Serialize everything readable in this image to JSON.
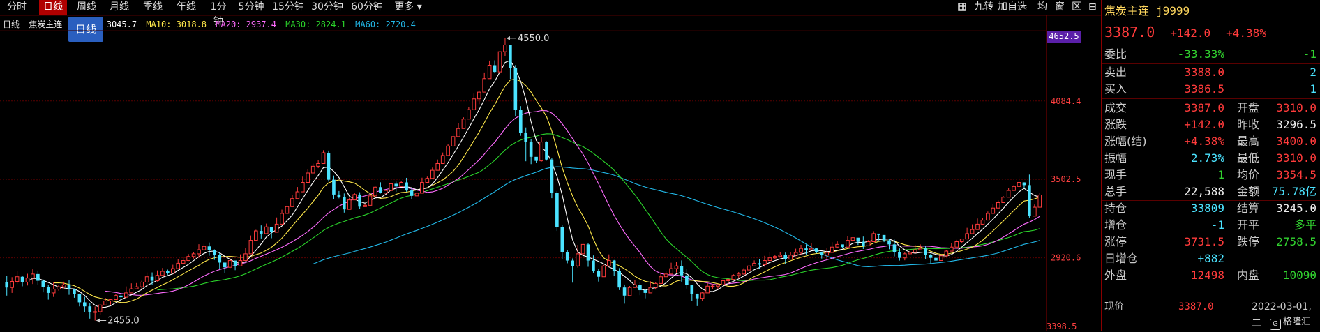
{
  "periods": [
    "分时",
    "日线",
    "周线",
    "月线",
    "季线",
    "年线",
    "1分钟",
    "5分钟",
    "15分钟",
    "30分钟",
    "60分钟",
    "更多 ▾"
  ],
  "active_period": 1,
  "tools": [
    "九转",
    "加自选",
    "均",
    "窗",
    "区"
  ],
  "legend": {
    "period": "日线",
    "name": "焦炭主连",
    "ma5": "3045.7",
    "ma10": "MA10: 3018.8",
    "ma20": "MA20: 2937.4",
    "ma30": "MA30: 2824.1",
    "ma60": "MA60: 2720.4"
  },
  "tooltip_label": "日线",
  "price_box": "4652.5",
  "colors": {
    "up": "#ff3b3b",
    "down": "#4be3ff",
    "ma5": "#ffffff",
    "ma10": "#ffe84a",
    "ma20": "#ff6cff",
    "ma30": "#2bd42b",
    "ma60": "#22b8e8",
    "grid": "#5a0000"
  },
  "panel": {
    "title": "焦炭主连",
    "code": "j9999",
    "price": "3387.0",
    "change": "+142.0",
    "change_pct": "+4.38%",
    "weibi": {
      "label": "委比",
      "pct": "-33.33%",
      "val": "-1"
    },
    "sell": {
      "label": "卖出",
      "price": "3388.0",
      "vol": "2"
    },
    "buy": {
      "label": "买入",
      "price": "3386.5",
      "vol": "1"
    },
    "rows": [
      {
        "l1": "成交",
        "v1": "3387.0",
        "c1": "red",
        "l2": "开盘",
        "v2": "3310.0",
        "c2": "red"
      },
      {
        "l1": "涨跌",
        "v1": "+142.0",
        "c1": "red",
        "l2": "昨收",
        "v2": "3296.5",
        "c2": "white"
      },
      {
        "l1": "涨幅(结)",
        "v1": "+4.38%",
        "c1": "red",
        "l2": "最高",
        "v2": "3400.0",
        "c2": "red"
      },
      {
        "l1": "振幅",
        "v1": "2.73%",
        "c1": "cyan",
        "l2": "最低",
        "v2": "3310.0",
        "c2": "red"
      },
      {
        "l1": "现手",
        "v1": "1",
        "c1": "green",
        "l2": "均价",
        "v2": "3354.5",
        "c2": "red"
      },
      {
        "l1": "总手",
        "v1": "22,588",
        "c1": "white",
        "l2": "金额",
        "v2": "75.78亿",
        "c2": "cyan"
      },
      {
        "l1": "持仓",
        "v1": "33809",
        "c1": "cyan",
        "l2": "结算",
        "v2": "3245.0",
        "c2": "white"
      },
      {
        "l1": "增仓",
        "v1": "-1",
        "c1": "cyan",
        "l2": "开平",
        "v2": "多平",
        "c2": "green"
      },
      {
        "l1": "涨停",
        "v1": "3731.5",
        "c1": "red",
        "l2": "跌停",
        "v2": "2758.5",
        "c2": "green"
      },
      {
        "l1": "日增仓",
        "v1": "+882",
        "c1": "cyan",
        "l2": "",
        "v2": "",
        "c2": "white"
      },
      {
        "l1": "外盘",
        "v1": "12498",
        "c1": "red",
        "l2": "内盘",
        "v2": "10090",
        "c2": "green"
      }
    ],
    "bottom": {
      "label": "现价",
      "price": "3387.0",
      "time": "2022-03-01,二"
    },
    "logo": "格隆汇"
  },
  "chart_data": {
    "type": "candlestick",
    "y_ticks": [
      "4084.4",
      "3502.5",
      "2920.6"
    ],
    "y_tick_values": [
      4084.4,
      3502.5,
      2920.6
    ],
    "ylim": [
      2380,
      4720
    ],
    "bottom_label": "3398.5",
    "annotations": [
      {
        "text": "4550.0",
        "value": 4550.0,
        "index": 96
      },
      {
        "text": "2455.0",
        "value": 2455.0,
        "index": 17
      }
    ],
    "candles": [
      [
        2740,
        2700,
        2784,
        2640
      ],
      [
        2700,
        2745,
        2777,
        2660
      ],
      [
        2745,
        2780,
        2821,
        2726
      ],
      [
        2780,
        2740,
        2788,
        2709
      ],
      [
        2740,
        2770,
        2802,
        2715
      ],
      [
        2770,
        2800,
        2835,
        2726
      ],
      [
        2800,
        2750,
        2826,
        2717
      ],
      [
        2750,
        2706,
        2760,
        2664
      ],
      [
        2706,
        2660,
        2718,
        2610
      ],
      [
        2660,
        2688,
        2741,
        2630
      ],
      [
        2688,
        2705,
        2719,
        2676
      ],
      [
        2705,
        2720,
        2743,
        2693
      ],
      [
        2720,
        2686,
        2755,
        2646
      ],
      [
        2686,
        2650,
        2665,
        2624
      ],
      [
        2650,
        2590,
        2655,
        2560
      ],
      [
        2590,
        2560,
        2631,
        2518
      ],
      [
        2560,
        2520,
        2582,
        2469
      ],
      [
        2520,
        2520,
        2559,
        2455
      ],
      [
        2520,
        2570,
        2576,
        2496
      ],
      [
        2570,
        2600,
        2623,
        2567
      ],
      [
        2600,
        2610,
        2615,
        2573
      ],
      [
        2610,
        2640,
        2652,
        2618
      ],
      [
        2640,
        2628,
        2650,
        2589
      ],
      [
        2628,
        2660,
        2708,
        2625
      ],
      [
        2660,
        2690,
        2731,
        2665
      ],
      [
        2690,
        2705,
        2733,
        2696
      ],
      [
        2705,
        2740,
        2750,
        2688
      ],
      [
        2740,
        2780,
        2812,
        2704
      ],
      [
        2780,
        2750,
        2812,
        2721
      ],
      [
        2750,
        2790,
        2827,
        2744
      ],
      [
        2790,
        2820,
        2845,
        2815
      ],
      [
        2820,
        2806,
        2833,
        2795
      ],
      [
        2806,
        2840,
        2869,
        2835
      ],
      [
        2840,
        2880,
        2908,
        2854
      ],
      [
        2880,
        2900,
        2925,
        2872
      ],
      [
        2900,
        2930,
        2948,
        2897
      ],
      [
        2930,
        2950,
        2965,
        2915
      ],
      [
        2950,
        2980,
        3021,
        2924
      ],
      [
        2980,
        3005,
        3024,
        2996
      ],
      [
        3005,
        2976,
        3034,
        2936
      ],
      [
        2976,
        2940,
        2983,
        2905
      ],
      [
        2940,
        2885,
        2962,
        2837
      ],
      [
        2885,
        2850,
        2882,
        2806
      ],
      [
        2850,
        2900,
        2935,
        2842
      ],
      [
        2900,
        2860,
        2876,
        2829
      ],
      [
        2860,
        2900,
        2946,
        2873
      ],
      [
        2900,
        2950,
        2991,
        2934
      ],
      [
        2950,
        3050,
        3086,
        2954
      ],
      [
        3050,
        3120,
        3128,
        3077
      ],
      [
        3120,
        3100,
        3161,
        3064
      ],
      [
        3100,
        3150,
        3174,
        3112
      ],
      [
        3150,
        3110,
        3149,
        3066
      ],
      [
        3110,
        3170,
        3220,
        3119
      ],
      [
        3170,
        3250,
        3278,
        3231
      ],
      [
        3250,
        3300,
        3326,
        3295
      ],
      [
        3300,
        3360,
        3387,
        3335
      ],
      [
        3360,
        3410,
        3446,
        3362
      ],
      [
        3410,
        3480,
        3523,
        3449
      ],
      [
        3480,
        3550,
        3579,
        3544
      ],
      [
        3550,
        3600,
        3620,
        3595
      ],
      [
        3600,
        3620,
        3648,
        3586
      ],
      [
        3620,
        3700,
        3719,
        3671
      ],
      [
        3700,
        3500,
        3716,
        3486
      ],
      [
        3500,
        3390,
        3531,
        3358
      ],
      [
        3390,
        3370,
        3416,
        3362
      ],
      [
        3370,
        3280,
        3398,
        3256
      ],
      [
        3280,
        3350,
        3365,
        3339
      ],
      [
        3350,
        3390,
        3404,
        3358
      ],
      [
        3390,
        3300,
        3407,
        3284
      ],
      [
        3300,
        3310,
        3322,
        3308
      ],
      [
        3310,
        3380,
        3387,
        3339
      ],
      [
        3380,
        3445,
        3449,
        3406
      ],
      [
        3445,
        3400,
        3481,
        3398
      ],
      [
        3400,
        3420,
        3426,
        3403
      ],
      [
        3420,
        3470,
        3471,
        3465
      ],
      [
        3470,
        3450,
        3486,
        3410
      ],
      [
        3450,
        3480,
        3488,
        3477
      ],
      [
        3480,
        3420,
        3514,
        3411
      ],
      [
        3420,
        3380,
        3439,
        3358
      ],
      [
        3380,
        3400,
        3406,
        3366
      ],
      [
        3400,
        3480,
        3515,
        3449
      ],
      [
        3480,
        3510,
        3523,
        3503
      ],
      [
        3510,
        3570,
        3590,
        3554
      ],
      [
        3570,
        3620,
        3650,
        3587
      ],
      [
        3620,
        3680,
        3702,
        3629
      ],
      [
        3680,
        3750,
        3767,
        3722
      ],
      [
        3750,
        3820,
        3843,
        3745
      ],
      [
        3820,
        3880,
        3919,
        3848
      ],
      [
        3880,
        3950,
        3963,
        3936
      ],
      [
        3950,
        4020,
        4037,
        3979
      ],
      [
        4020,
        4100,
        4139,
        4082
      ],
      [
        4100,
        4150,
        4162,
        4061
      ],
      [
        4150,
        4250,
        4296,
        4200
      ],
      [
        4250,
        4350,
        4384,
        4315
      ],
      [
        4350,
        4300,
        4386,
        4290
      ],
      [
        4300,
        4450,
        4483,
        4348
      ],
      [
        4450,
        4500,
        4550,
        4418
      ],
      [
        4500,
        4330,
        4493,
        4247
      ],
      [
        4330,
        4020,
        4351,
        3971
      ],
      [
        4020,
        3850,
        4046,
        3826
      ],
      [
        3850,
        3780,
        3888,
        3637
      ],
      [
        3780,
        3670,
        3803,
        3616
      ],
      [
        3670,
        3640,
        3657,
        3625
      ],
      [
        3640,
        3780,
        3815,
        3634
      ],
      [
        3780,
        3650,
        3785,
        3642
      ],
      [
        3650,
        3400,
        3664,
        3363
      ],
      [
        3400,
        3150,
        3415,
        3120
      ],
      [
        3150,
        2960,
        3165,
        2911
      ],
      [
        2960,
        2900,
        2978,
        2880
      ],
      [
        2900,
        2860,
        2916,
        2736
      ],
      [
        2860,
        2950,
        3016,
        2848
      ],
      [
        2950,
        3020,
        3034,
        2991
      ],
      [
        3020,
        2900,
        3030,
        2854
      ],
      [
        2900,
        2820,
        2938,
        2810
      ],
      [
        2820,
        2780,
        2839,
        2744
      ],
      [
        2780,
        2860,
        2868,
        2781
      ],
      [
        2860,
        2900,
        2946,
        2853
      ],
      [
        2900,
        2820,
        2904,
        2788
      ],
      [
        2820,
        2700,
        2844,
        2681
      ],
      [
        2700,
        2640,
        2722,
        2580
      ],
      [
        2640,
        2700,
        2711,
        2664
      ],
      [
        2700,
        2720,
        2757,
        2698
      ],
      [
        2720,
        2680,
        2739,
        2643
      ],
      [
        2680,
        2660,
        2690,
        2620
      ],
      [
        2660,
        2700,
        2747,
        2672
      ],
      [
        2700,
        2730,
        2740,
        2685
      ],
      [
        2730,
        2780,
        2814,
        2742
      ],
      [
        2780,
        2800,
        2822,
        2788
      ],
      [
        2800,
        2840,
        2884,
        2838
      ],
      [
        2840,
        2860,
        2890,
        2811
      ],
      [
        2860,
        2790,
        2901,
        2743
      ],
      [
        2790,
        2720,
        2839,
        2692
      ],
      [
        2720,
        2650,
        2720,
        2600
      ],
      [
        2650,
        2620,
        2655,
        2562
      ],
      [
        2620,
        2660,
        2668,
        2600
      ],
      [
        2660,
        2710,
        2733,
        2667
      ],
      [
        2710,
        2710,
        2725,
        2690
      ],
      [
        2710,
        2720,
        2727,
        2687
      ],
      [
        2720,
        2750,
        2763,
        2728
      ],
      [
        2750,
        2760,
        2767,
        2729
      ],
      [
        2760,
        2790,
        2798,
        2789
      ],
      [
        2790,
        2800,
        2815,
        2770
      ],
      [
        2800,
        2830,
        2844,
        2792
      ],
      [
        2830,
        2860,
        2864,
        2858
      ],
      [
        2860,
        2880,
        2901,
        2869
      ],
      [
        2880,
        2870,
        2909,
        2840
      ],
      [
        2870,
        2900,
        2935,
        2854
      ],
      [
        2900,
        2920,
        2962,
        2913
      ],
      [
        2920,
        2930,
        2944,
        2912
      ],
      [
        2930,
        2940,
        2961,
        2934
      ],
      [
        2940,
        2910,
        2959,
        2875
      ],
      [
        2910,
        2940,
        2964,
        2934
      ],
      [
        2940,
        2960,
        2988,
        2935
      ],
      [
        2960,
        2990,
        3017,
        2941
      ],
      [
        2990,
        2980,
        3019,
        2945
      ],
      [
        2980,
        2990,
        3030,
        2986
      ],
      [
        2990,
        2960,
        2996,
        2954
      ],
      [
        2960,
        2940,
        2961,
        2915
      ],
      [
        2940,
        2960,
        2991,
        2911
      ],
      [
        2960,
        3000,
        3036,
        2962
      ],
      [
        3000,
        3020,
        3042,
        2991
      ],
      [
        3020,
        3000,
        3018,
        2993
      ],
      [
        3000,
        3050,
        3080,
        3024
      ],
      [
        3050,
        3070,
        3071,
        3035
      ],
      [
        3070,
        3040,
        3061,
        3016
      ],
      [
        3040,
        3010,
        3078,
        2986
      ],
      [
        3010,
        3040,
        3052,
        3026
      ],
      [
        3040,
        3100,
        3118,
        3086
      ],
      [
        3100,
        3090,
        3095,
        3049
      ],
      [
        3090,
        3050,
        3082,
        3037
      ],
      [
        3050,
        3020,
        3063,
        2984
      ],
      [
        3020,
        2960,
        3055,
        2931
      ],
      [
        2960,
        2920,
        2990,
        2900
      ],
      [
        2920,
        2950,
        2962,
        2902
      ],
      [
        2950,
        2960,
        2970,
        2939
      ],
      [
        2960,
        2980,
        3017,
        2957
      ],
      [
        2980,
        2990,
        3020,
        2984
      ],
      [
        2990,
        2940,
        3010,
        2913
      ],
      [
        2940,
        2920,
        2951,
        2874
      ],
      [
        2920,
        2900,
        2925,
        2888
      ],
      [
        2900,
        2935,
        2933,
        2921
      ],
      [
        2935,
        2970,
        2976,
        2931
      ],
      [
        2970,
        3000,
        3030,
        2974
      ],
      [
        3000,
        3040,
        3054,
        3039
      ],
      [
        3040,
        3060,
        3063,
        3033
      ],
      [
        3060,
        3100,
        3143,
        3093
      ],
      [
        3100,
        3130,
        3169,
        3108
      ],
      [
        3130,
        3170,
        3212,
        3168
      ],
      [
        3170,
        3200,
        3214,
        3165
      ],
      [
        3200,
        3250,
        3264,
        3223
      ],
      [
        3250,
        3290,
        3321,
        3264
      ],
      [
        3290,
        3330,
        3346,
        3287
      ],
      [
        3330,
        3370,
        3378,
        3364
      ],
      [
        3370,
        3420,
        3438,
        3415
      ],
      [
        3420,
        3450,
        3459,
        3429
      ],
      [
        3450,
        3480,
        3524,
        3450
      ],
      [
        3480,
        3460,
        3481,
        3435
      ],
      [
        3460,
        3230,
        3538,
        3219
      ],
      [
        3230,
        3296,
        3316,
        3268
      ],
      [
        3296,
        3387,
        3400,
        3310
      ]
    ]
  }
}
